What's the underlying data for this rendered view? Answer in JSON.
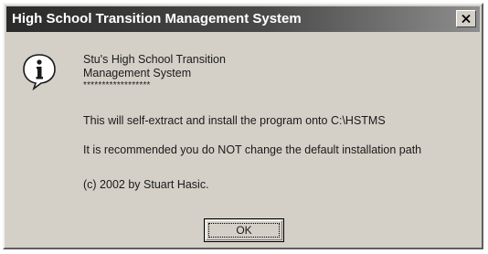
{
  "window": {
    "title": "High School Transition Management System",
    "close_label": "x"
  },
  "message": {
    "icon": "info-icon",
    "heading_line1": "Stu's High School Transition",
    "heading_line2": "Management System",
    "separator": "******************",
    "line_install": "This will self-extract and install the program onto C:\\HSTMS",
    "line_recommend": "It is recommended you do NOT change the default installation path",
    "line_copyright": "(c) 2002 by Stuart Hasic."
  },
  "buttons": {
    "ok_label": "OK"
  }
}
